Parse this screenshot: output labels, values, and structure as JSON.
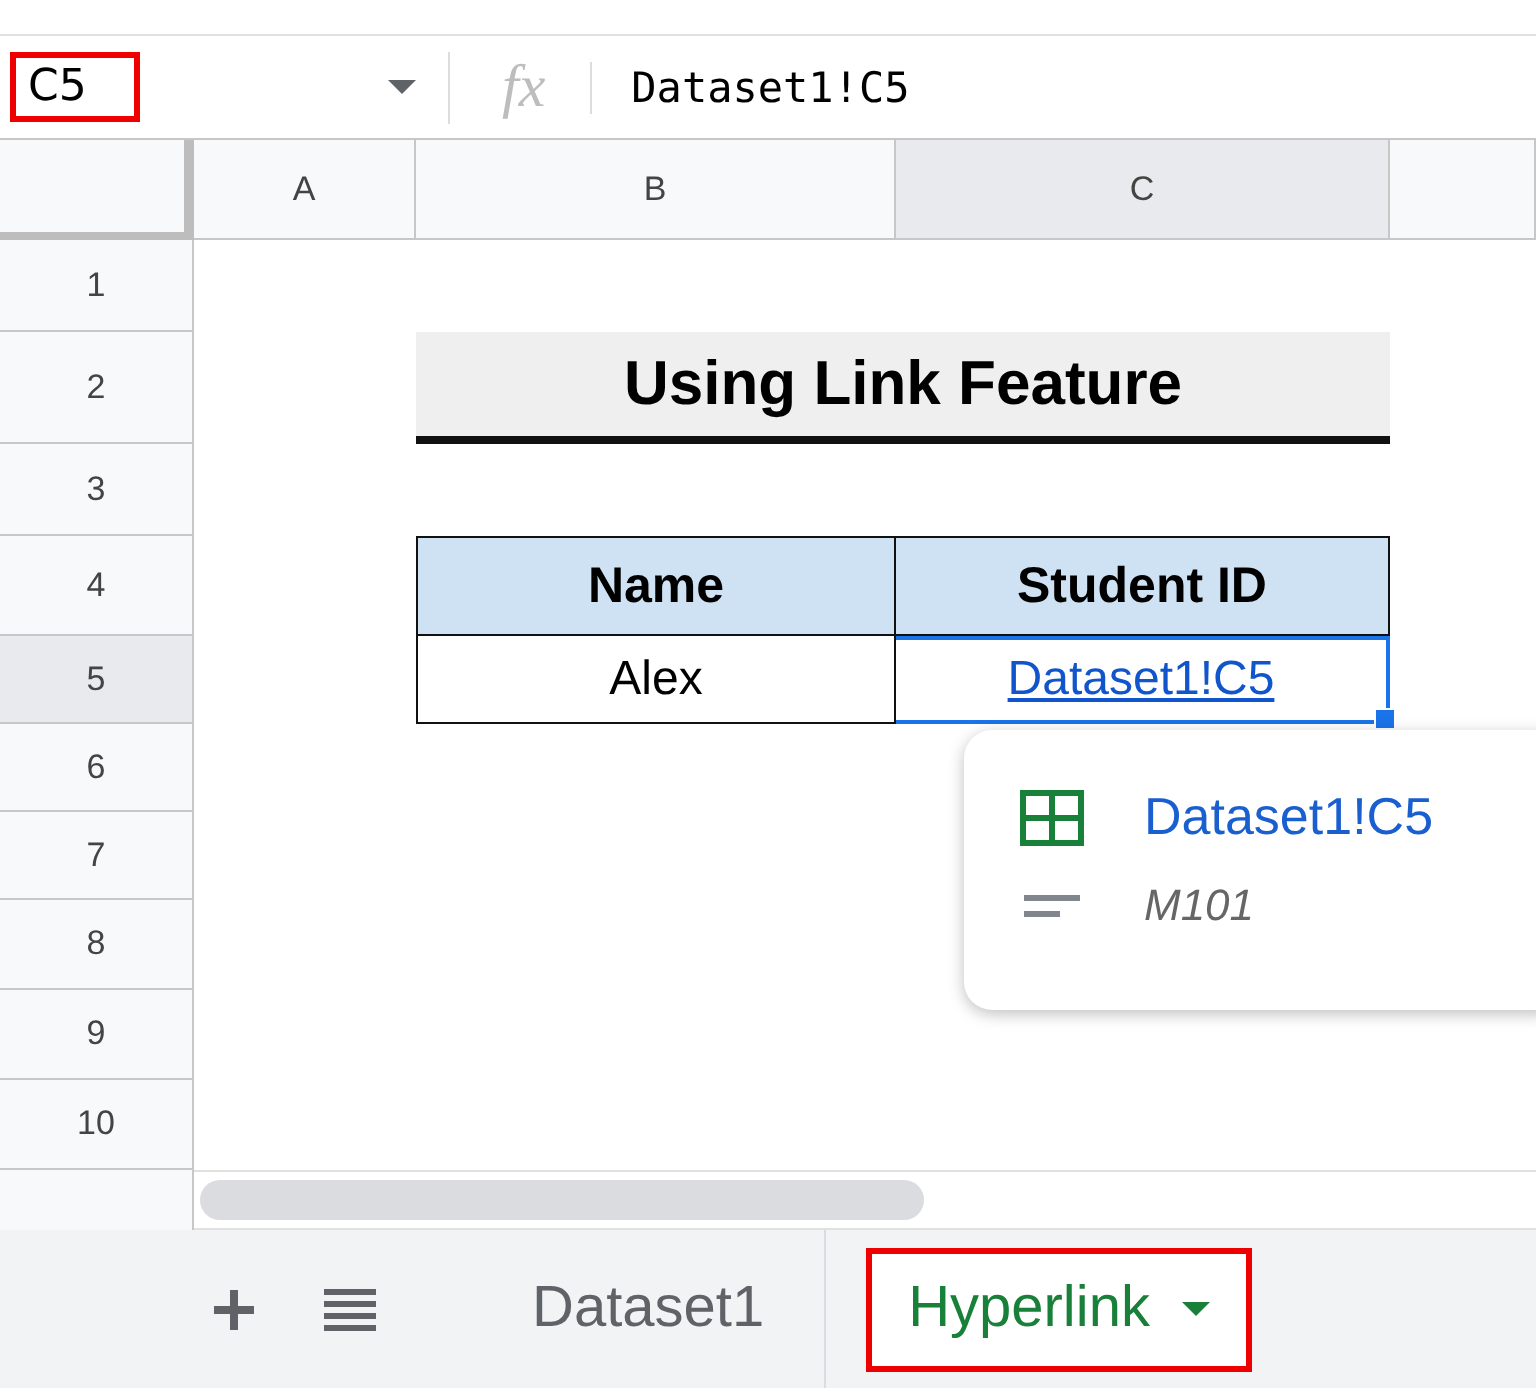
{
  "name_box": {
    "value": "C5"
  },
  "formula_bar": {
    "fx": "fx",
    "value": "Dataset1!C5"
  },
  "columns": [
    {
      "label": "A",
      "selected": false
    },
    {
      "label": "B",
      "selected": false
    },
    {
      "label": "C",
      "selected": true
    }
  ],
  "rows": [
    {
      "label": "1",
      "selected": false
    },
    {
      "label": "2",
      "selected": false
    },
    {
      "label": "3",
      "selected": false
    },
    {
      "label": "4",
      "selected": false
    },
    {
      "label": "5",
      "selected": true
    },
    {
      "label": "6",
      "selected": false
    },
    {
      "label": "7",
      "selected": false
    },
    {
      "label": "8",
      "selected": false
    },
    {
      "label": "9",
      "selected": false
    },
    {
      "label": "10",
      "selected": false
    }
  ],
  "table": {
    "title": "Using Link Feature",
    "columns": [
      "Name",
      "Student ID"
    ],
    "row": {
      "name": "Alex",
      "student_id": "Dataset1!C5"
    }
  },
  "link_popup": {
    "link": "Dataset1!C5",
    "value": "M101"
  },
  "sheet_tabs": [
    {
      "label": "Dataset1",
      "selected": false
    },
    {
      "label": "Hyperlink",
      "selected": true
    }
  ]
}
